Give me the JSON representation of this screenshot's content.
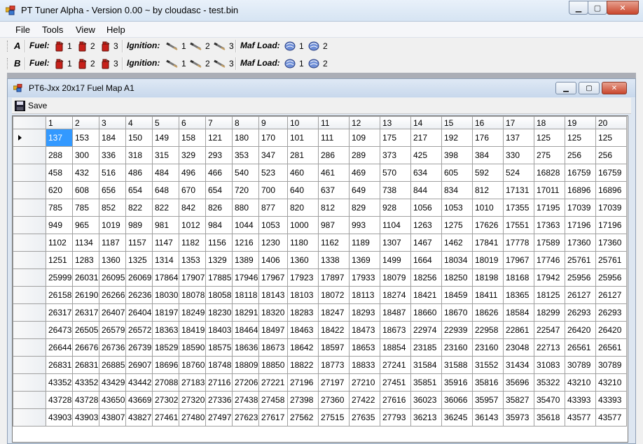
{
  "window": {
    "title": "PT Tuner Alpha - Version 0.00 ~ by cloudasc - test.bin"
  },
  "menu": [
    "File",
    "Tools",
    "View",
    "Help"
  ],
  "toolbars": [
    {
      "letter": "A",
      "fuel_label": "Fuel:",
      "ignition_label": "Ignition:",
      "maf_label": "Maf Load:",
      "fuel": [
        "1",
        "2",
        "3"
      ],
      "ignition": [
        "1",
        "2",
        "3"
      ],
      "maf": [
        "1",
        "2"
      ]
    },
    {
      "letter": "B",
      "fuel_label": "Fuel:",
      "ignition_label": "Ignition:",
      "maf_label": "Maf Load:",
      "fuel": [
        "1",
        "2",
        "3"
      ],
      "ignition": [
        "1",
        "2",
        "3"
      ],
      "maf": [
        "1",
        "2"
      ]
    }
  ],
  "child": {
    "title": "PT6-Jxx 20x17 Fuel Map A1",
    "save_label": "Save",
    "columns": [
      "1",
      "2",
      "3",
      "4",
      "5",
      "6",
      "7",
      "8",
      "9",
      "10",
      "11",
      "12",
      "13",
      "14",
      "15",
      "16",
      "17",
      "18",
      "19",
      "20"
    ],
    "selected": {
      "row": 0,
      "col": 0
    },
    "rows": [
      [
        137,
        153,
        184,
        150,
        149,
        158,
        121,
        180,
        170,
        101,
        111,
        109,
        175,
        217,
        192,
        176,
        137,
        125,
        125,
        125
      ],
      [
        288,
        300,
        336,
        318,
        315,
        329,
        293,
        353,
        347,
        281,
        286,
        289,
        373,
        425,
        398,
        384,
        330,
        275,
        256,
        256
      ],
      [
        458,
        432,
        516,
        486,
        484,
        496,
        466,
        540,
        523,
        460,
        461,
        469,
        570,
        634,
        605,
        592,
        524,
        16828,
        16759,
        16759
      ],
      [
        620,
        608,
        656,
        654,
        648,
        670,
        654,
        720,
        700,
        640,
        637,
        649,
        738,
        844,
        834,
        812,
        17131,
        17011,
        16896,
        16896
      ],
      [
        785,
        785,
        852,
        822,
        822,
        842,
        826,
        880,
        877,
        820,
        812,
        829,
        928,
        1056,
        1053,
        1010,
        17355,
        17195,
        17039,
        17039
      ],
      [
        949,
        965,
        1019,
        989,
        981,
        1012,
        984,
        1044,
        1053,
        1000,
        987,
        993,
        1104,
        1263,
        1275,
        17626,
        17551,
        17363,
        17196,
        17196
      ],
      [
        1102,
        1134,
        1187,
        1157,
        1147,
        1182,
        1156,
        1216,
        1230,
        1180,
        1162,
        1189,
        1307,
        1467,
        1462,
        17841,
        17778,
        17589,
        17360,
        17360
      ],
      [
        1251,
        1283,
        1360,
        1325,
        1314,
        1353,
        1329,
        1389,
        1406,
        1360,
        1338,
        1369,
        1499,
        1664,
        18034,
        18019,
        17967,
        17746,
        25761,
        25761
      ],
      [
        25999,
        26031,
        26095,
        26069,
        17864,
        17907,
        17885,
        17946,
        17967,
        17923,
        17897,
        17933,
        18079,
        18256,
        18250,
        18198,
        18168,
        17942,
        25956,
        25956
      ],
      [
        26158,
        26190,
        26266,
        26236,
        18030,
        18078,
        18058,
        18118,
        18143,
        18103,
        18072,
        18113,
        18274,
        18421,
        18459,
        18411,
        18365,
        18125,
        26127,
        26127
      ],
      [
        26317,
        26317,
        26407,
        26404,
        18197,
        18249,
        18230,
        18291,
        18320,
        18283,
        18247,
        18293,
        18487,
        18660,
        18670,
        18626,
        18584,
        18299,
        26293,
        26293
      ],
      [
        26473,
        26505,
        26579,
        26572,
        18363,
        18419,
        18403,
        18464,
        18497,
        18463,
        18422,
        18473,
        18673,
        22974,
        22939,
        22958,
        22861,
        22547,
        26420,
        26420
      ],
      [
        26644,
        26676,
        26736,
        26739,
        18529,
        18590,
        18575,
        18636,
        18673,
        18642,
        18597,
        18653,
        18854,
        23185,
        23160,
        23160,
        23048,
        22713,
        26561,
        26561
      ],
      [
        26831,
        26831,
        26885,
        26907,
        18696,
        18760,
        18748,
        18809,
        18850,
        18822,
        18773,
        18833,
        27241,
        31584,
        31588,
        31552,
        31434,
        31083,
        30789,
        30789
      ],
      [
        43352,
        43352,
        43429,
        43442,
        27088,
        27183,
        27116,
        27206,
        27221,
        27196,
        27197,
        27210,
        27451,
        35851,
        35916,
        35816,
        35696,
        35322,
        43210,
        43210
      ],
      [
        43728,
        43728,
        43650,
        43669,
        27302,
        27320,
        27336,
        27438,
        27458,
        27398,
        27360,
        27422,
        27616,
        36023,
        36066,
        35957,
        35827,
        35470,
        43393,
        43393
      ],
      [
        43903,
        43903,
        43807,
        43827,
        27461,
        27480,
        27497,
        27623,
        27617,
        27562,
        27515,
        27635,
        27793,
        36213,
        36245,
        36143,
        35973,
        35618,
        43577,
        43577
      ]
    ]
  }
}
